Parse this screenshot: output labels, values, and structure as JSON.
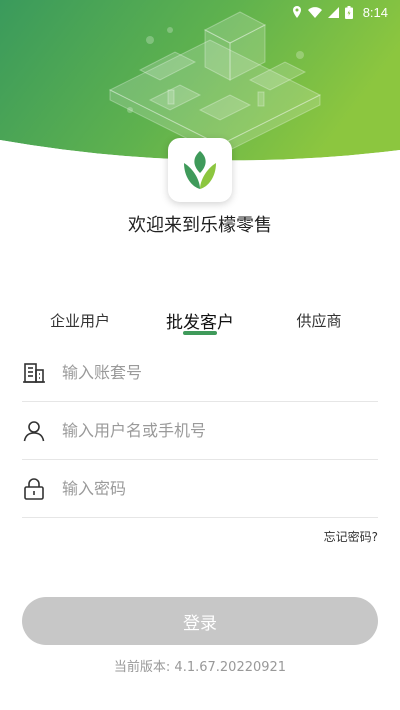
{
  "status_bar": {
    "time": "8:14"
  },
  "app": {
    "welcome": "欢迎来到乐檬零售"
  },
  "tabs": [
    {
      "label": "企业用户",
      "active": false
    },
    {
      "label": "批发客户",
      "active": true
    },
    {
      "label": "供应商",
      "active": false
    }
  ],
  "form": {
    "account_placeholder": "输入账套号",
    "username_placeholder": "输入用户名或手机号",
    "password_placeholder": "输入密码",
    "forgot_label": "忘记密码?"
  },
  "login_button": "登录",
  "version": "当前版本: 4.1.67.20220921",
  "colors": {
    "accent": "#3f9a5a",
    "header_left": "#3a9a5c",
    "header_right": "#8cc63f",
    "button_disabled": "#c7c7c7"
  },
  "icons": {
    "location": "location-icon",
    "wifi": "wifi-icon",
    "signal": "signal-icon",
    "battery": "battery-icon",
    "building": "building-icon",
    "user": "user-icon",
    "lock": "lock-icon",
    "logo": "leaf-logo-icon"
  }
}
